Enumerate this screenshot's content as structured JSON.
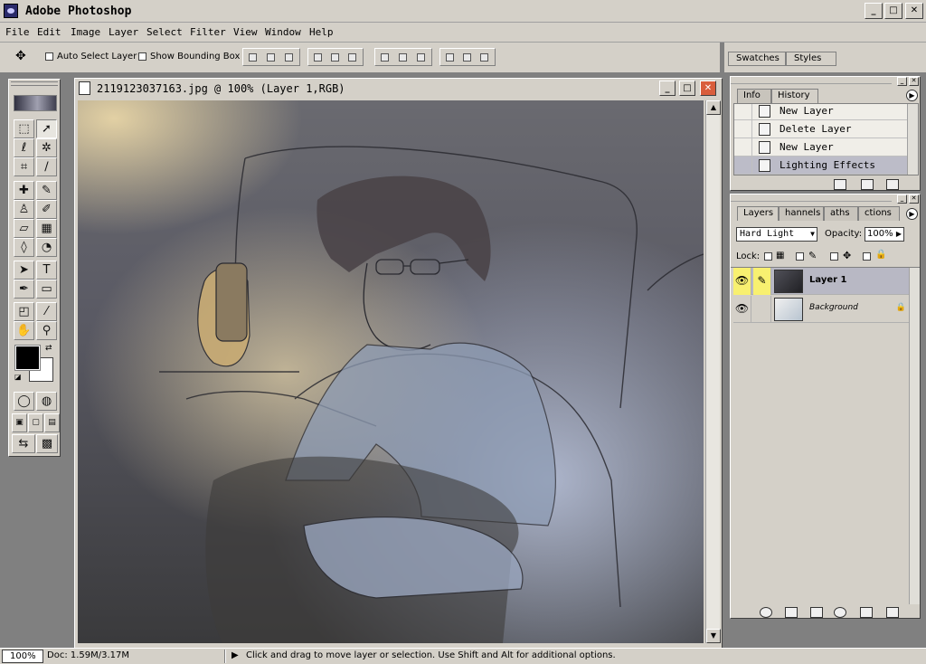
{
  "app": {
    "title": "Adobe Photoshop",
    "window_buttons": {
      "minimize": "_",
      "maximize": "□",
      "close": "✕"
    }
  },
  "menu": [
    "File",
    "Edit",
    "Image",
    "Layer",
    "Select",
    "Filter",
    "View",
    "Window",
    "Help"
  ],
  "options_bar": {
    "auto_select_label": "Auto Select Layer",
    "show_bounding_label": "Show Bounding Box"
  },
  "palette_well": {
    "tabs": [
      "Swatches",
      "Styles"
    ]
  },
  "toolbox": {
    "tools": [
      "marquee-icon",
      "move-icon",
      "lasso-icon",
      "magic-wand-icon",
      "crop-icon",
      "slice-icon",
      "healing-brush-icon",
      "brush-icon",
      "clone-stamp-icon",
      "history-brush-icon",
      "eraser-icon",
      "gradient-icon",
      "blur-icon",
      "dodge-icon",
      "path-select-icon",
      "type-icon",
      "pen-icon",
      "rectangle-icon",
      "notes-icon",
      "eyedropper-icon",
      "hand-icon",
      "zoom-icon"
    ],
    "foreground_color": "#000000",
    "background_color": "#ffffff"
  },
  "document": {
    "title": "2119123037163.jpg @ 100% (Layer 1,RGB)"
  },
  "history_panel": {
    "tabs": [
      "Info",
      "History"
    ],
    "items": [
      {
        "label": "New Layer",
        "selected": false
      },
      {
        "label": "Delete Layer",
        "selected": false
      },
      {
        "label": "New Layer",
        "selected": false
      },
      {
        "label": "Lighting Effects",
        "selected": true
      }
    ]
  },
  "layers_panel": {
    "tabs": [
      "Layers",
      "Channels",
      "Paths",
      "Actions"
    ],
    "tab_display": [
      "Layers",
      "hannels",
      "aths",
      "ctions"
    ],
    "blend_mode": "Hard Light",
    "opacity_label": "Opacity:",
    "opacity_value": "100%",
    "lock_label": "Lock:",
    "layers": [
      {
        "name": "Layer 1",
        "selected": true,
        "visible": true
      },
      {
        "name": "Background",
        "selected": false,
        "visible": true,
        "locked": true
      }
    ]
  },
  "status_bar": {
    "zoom": "100%",
    "doc_size": "Doc: 1.59M/3.17M",
    "hint": "Click and drag to move layer or selection.  Use Shift and Alt for additional options."
  }
}
